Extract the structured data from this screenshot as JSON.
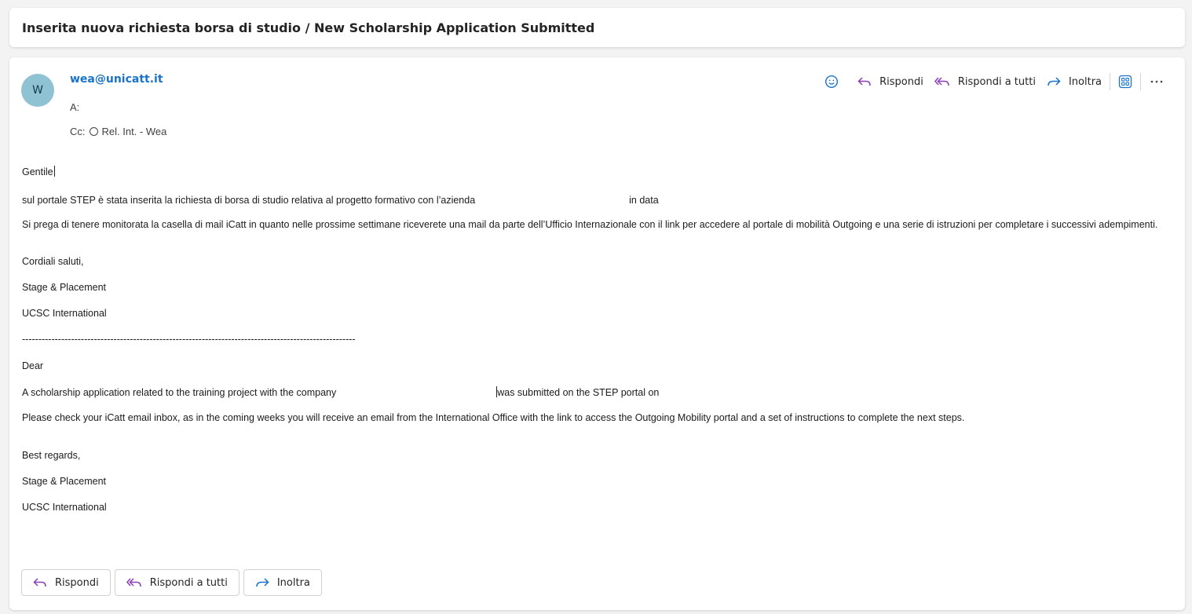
{
  "subject": "Inserita nuova richiesta borsa di studio / New Scholarship Application Submitted",
  "sender": {
    "initial": "W",
    "email": "wea@unicatt.it",
    "to_label": "A:",
    "cc_label": "Cc:",
    "cc_recipient": "Rel. Int. - Wea"
  },
  "toolbar": {
    "reply": "Rispondi",
    "reply_all": "Rispondi a tutti",
    "forward": "Inoltra"
  },
  "body": {
    "it": {
      "greeting": "Gentile",
      "line1_a": "sul portale STEP è stata inserita la richiesta di borsa di studio relativa al progetto formativo con l’azienda",
      "line1_b": "in data",
      "line2": "Si prega di tenere monitorata la casella di mail iCatt in quanto nelle prossime settimane riceverete una mail da parte dell’Ufficio Internazionale con il link per accedere al portale di mobilità Outgoing e una serie di istruzioni per completare i successivi adempimenti.",
      "closing": "Cordiali saluti,",
      "sig1": "Stage & Placement",
      "sig2": "UCSC International"
    },
    "divider": "------------------------------------------------------------------------------------------------------",
    "en": {
      "greeting": "Dear",
      "line1_a": "A scholarship application related to the training project with the company",
      "line1_b": "was submitted on the STEP portal on",
      "line2": "Please check your iCatt email inbox, as in the coming weeks you will receive an email from the International Office with the link to access the Outgoing Mobility portal and a set of instructions to complete the next steps.",
      "closing": "Best regards,",
      "sig1": "Stage & Placement",
      "sig2": "UCSC International"
    }
  },
  "actions": {
    "reply": "Rispondi",
    "reply_all": "Rispondi a tutti",
    "forward": "Inoltra"
  },
  "colors": {
    "accent": "#1a73c8",
    "reply_icon": "#8a3fb5",
    "forward_icon": "#1a73c8",
    "avatar_bg": "#8fc3d3"
  }
}
